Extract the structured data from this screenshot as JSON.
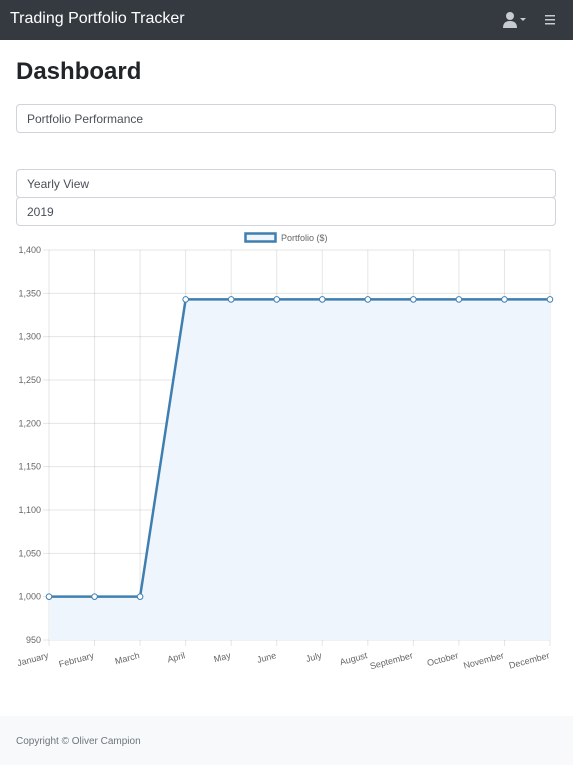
{
  "navbar": {
    "brand": "Trading Portfolio Tracker",
    "user_icon": "user-icon",
    "dropdown_icon": "caret-down-icon",
    "menu_icon": "hamburger-menu-icon"
  },
  "page": {
    "title": "Dashboard"
  },
  "controls": {
    "report_select": "Portfolio Performance",
    "view_select": "Yearly View",
    "year_select": "2019"
  },
  "chart_data": {
    "type": "area",
    "categories": [
      "January",
      "February",
      "March",
      "April",
      "May",
      "June",
      "July",
      "August",
      "September",
      "October",
      "November",
      "December"
    ],
    "series": [
      {
        "name": "Portfolio ($)",
        "values": [
          1000,
          1000,
          1000,
          1343,
          1343,
          1343,
          1343,
          1343,
          1343,
          1343,
          1343,
          1343
        ]
      }
    ],
    "ylim": [
      950,
      1400
    ],
    "yticks": [
      "1,400",
      "1,350",
      "1,300",
      "1,250",
      "1,200",
      "1,150",
      "1,100",
      "1,050",
      "1,000",
      "950"
    ],
    "grid": true,
    "legend": "top",
    "colors": {
      "line": "#3f7fb0",
      "fill": "#eef5fd"
    }
  },
  "footer": {
    "copyright": "Copyright © Oliver Campion"
  },
  "colors": {
    "navbar": "#343a40",
    "footer": "#f8f9fa"
  }
}
